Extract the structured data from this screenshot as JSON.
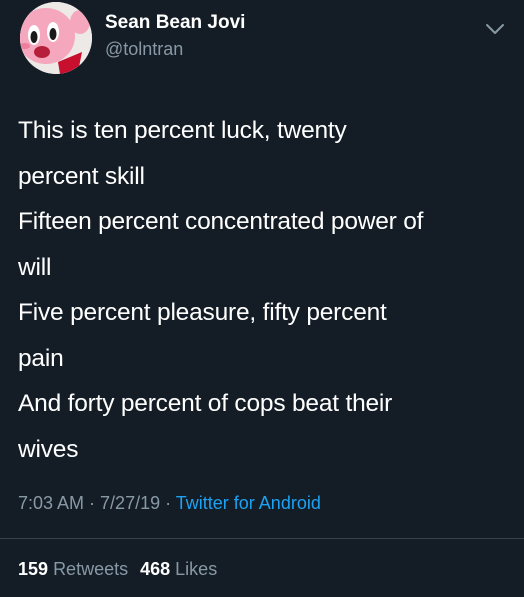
{
  "user": {
    "display_name": "Sean Bean Jovi",
    "handle": "@tolntran"
  },
  "tweet": {
    "lines": [
      "This is ten percent luck, twenty",
      "percent skill",
      "Fifteen percent concentrated power of",
      "will",
      "Five percent pleasure, fifty percent",
      "pain",
      "And forty percent of cops beat their",
      "wives"
    ]
  },
  "meta": {
    "time": "7:03 AM",
    "sep1": " · ",
    "date": "7/27/19",
    "sep2": " · ",
    "source": "Twitter for Android"
  },
  "stats": {
    "retweets_count": "159",
    "retweets_label": "Retweets",
    "likes_count": "468",
    "likes_label": "Likes"
  },
  "colors": {
    "background": "#141d26",
    "text": "#ffffff",
    "secondary": "#8899a6",
    "link": "#1da1f2",
    "divider": "#38444d"
  },
  "icons": {
    "avatar": "kirby-avatar",
    "menu": "chevron-down-icon"
  }
}
